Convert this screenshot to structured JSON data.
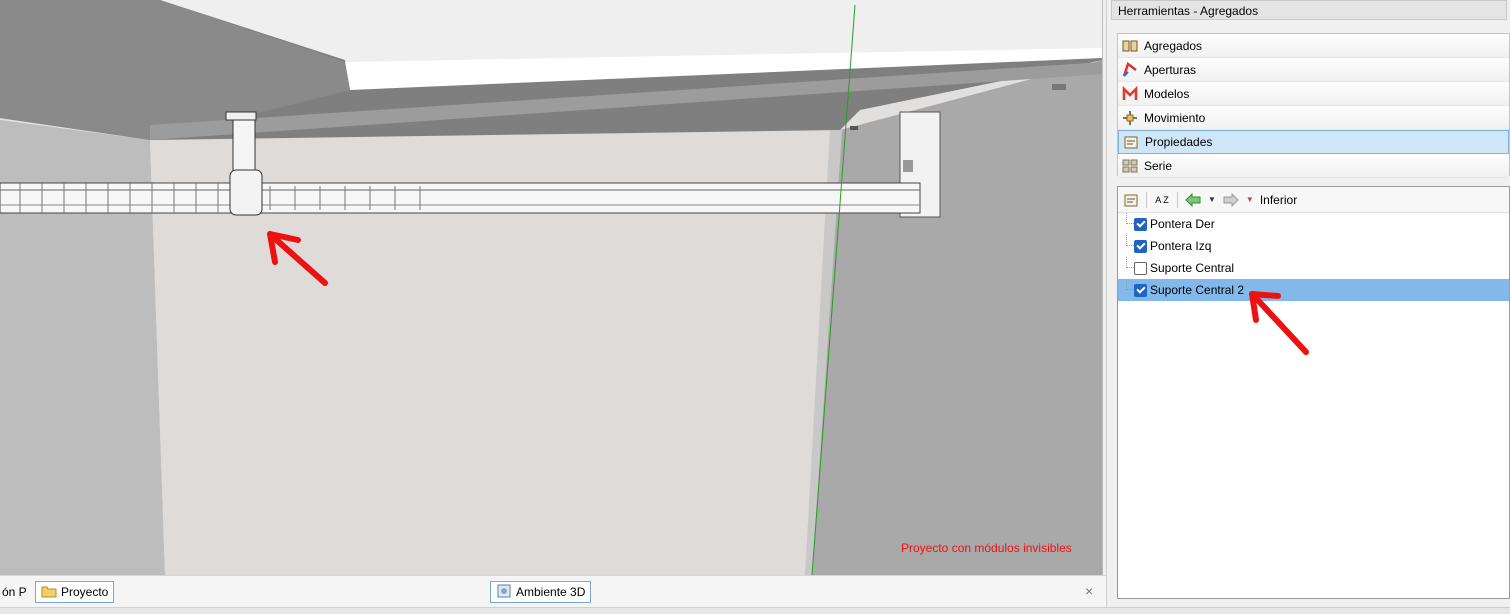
{
  "viewport": {
    "note": "Proyecto con módulos invisibles",
    "note_color": "#ee1111"
  },
  "bottom_tabs": {
    "partial_label": "ón P",
    "proyecto_label": "Proyecto",
    "ambiente_label": "Ambiente 3D",
    "close_symbol": "×"
  },
  "panel": {
    "title": "Herramientas - Agregados"
  },
  "tools": [
    {
      "label": "Agregados",
      "icon": "agregados-icon",
      "selected": false
    },
    {
      "label": "Aperturas",
      "icon": "aperturas-icon",
      "selected": false
    },
    {
      "label": "Modelos",
      "icon": "modelos-icon",
      "selected": false
    },
    {
      "label": "Movimiento",
      "icon": "movimiento-icon",
      "selected": false
    },
    {
      "label": "Propiedades",
      "icon": "propiedades-icon",
      "selected": true
    },
    {
      "label": "Serie",
      "icon": "serie-icon",
      "selected": false
    }
  ],
  "props_toolbar": {
    "sort_label": "A Z",
    "location_label": "Inferior"
  },
  "tree_items": [
    {
      "label": "Pontera Der",
      "checked": true,
      "selected": false
    },
    {
      "label": "Pontera Izq",
      "checked": true,
      "selected": false
    },
    {
      "label": "Suporte Central",
      "checked": false,
      "selected": false
    },
    {
      "label": "Suporte Central 2",
      "checked": true,
      "selected": true
    }
  ],
  "colors": {
    "selection": "#83b9ea",
    "accent": "#1d64c4",
    "arrow": "#ee1111"
  }
}
